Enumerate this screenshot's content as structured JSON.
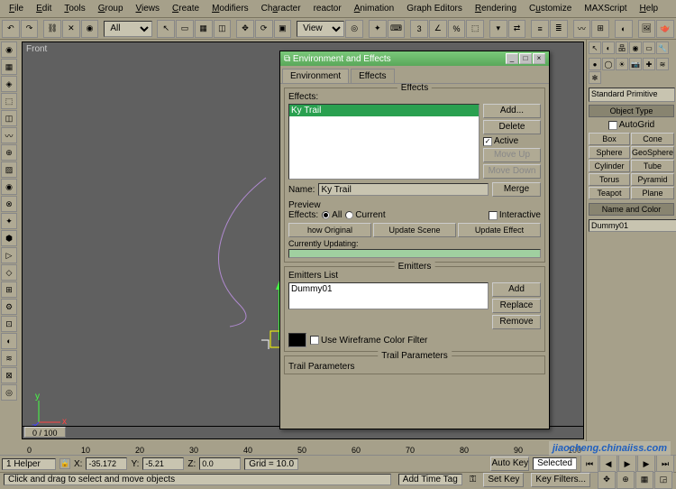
{
  "menus": [
    "File",
    "Edit",
    "Tools",
    "Group",
    "Views",
    "Create",
    "Modifiers",
    "Character",
    "reactor",
    "Animation",
    "Graph Editors",
    "Rendering",
    "Customize",
    "MAXScript",
    "Help"
  ],
  "toolbar": {
    "selfilter": "All",
    "refcoord": "View"
  },
  "viewport": {
    "label": "Front",
    "timeslider": "0 / 100"
  },
  "ruler": {
    "ticks": [
      0,
      10,
      20,
      30,
      40,
      50,
      60,
      70,
      80,
      90,
      100
    ]
  },
  "rightpanel": {
    "category": "Standard Primitive",
    "rollout_objtype": "Object Type",
    "autogrid": "AutoGrid",
    "buttons": [
      "Box",
      "Cone",
      "Sphere",
      "GeoSphere",
      "Cylinder",
      "Tube",
      "Torus",
      "Pyramid",
      "Teapot",
      "Plane"
    ],
    "rollout_name": "Name and Color",
    "name_value": "Dummy01"
  },
  "dialog": {
    "title": "Environment and Effects",
    "tabs": [
      "Environment",
      "Effects"
    ],
    "effects": {
      "group": "Effects",
      "list_label": "Effects:",
      "list_sel": "Ky Trail",
      "btn_add": "Add...",
      "btn_delete": "Delete",
      "chk_active": "Active",
      "btn_moveup": "Move Up",
      "btn_movedown": "Move Down",
      "name_label": "Name:",
      "name_value": "Ky Trail",
      "btn_merge": "Merge"
    },
    "preview": {
      "group": "Preview",
      "effects_label": "Effects:",
      "opt_all": "All",
      "opt_current": "Current",
      "chk_interact": "Interactive",
      "btn_show": "how Original",
      "btn_update": "Update Scene",
      "btn_updeff": "Update Effect",
      "updating": "Currently Updating:"
    },
    "emitters": {
      "group": "Emitters",
      "list_label": "Emitters List",
      "item": "Dummy01",
      "btn_add": "Add",
      "btn_replace": "Replace",
      "btn_remove": "Remove",
      "chk_filter": "Use Wireframe Color Filter"
    },
    "trail": {
      "group": "Trail Parameters",
      "sub": "Trail Parameters"
    }
  },
  "status": {
    "selinfo": "1 Helper",
    "x": "-35.172",
    "y": "-5.21",
    "z": "0.0",
    "grid": "Grid = 10.0",
    "hint": "Click and drag to select and move objects",
    "addtag": "Add Time Tag",
    "autokey": "Auto Key",
    "selected": "Selected",
    "setkey": "Set Key",
    "keyfilters": "Key Filters..."
  },
  "watermark": "jiaocheng.chinaiiss.com"
}
